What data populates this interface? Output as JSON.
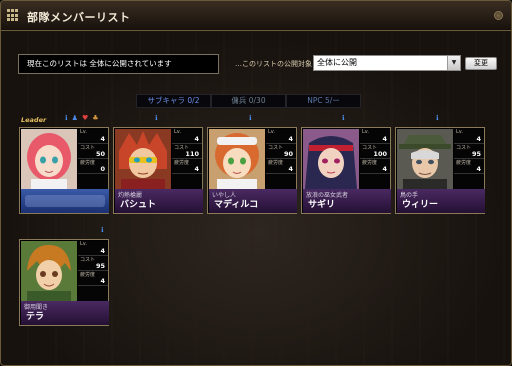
{
  "window": {
    "title": "部隊メンバーリスト"
  },
  "status": {
    "text": "現在このリストは 全体に公開されています"
  },
  "scope": {
    "label": "…このリストの公開対象",
    "selected": "全体に公開",
    "change_label": "変更"
  },
  "counts": {
    "sub": "サブキャラ 0/2",
    "merc": "傭兵 0/30",
    "npc": "NPC 5/ー"
  },
  "leader_label": "Leader",
  "stat_labels": {
    "lv": "Lv.",
    "cost": "コスト",
    "fatigue": "疲労度"
  },
  "members": [
    {
      "title": "",
      "name": "",
      "lv": "4",
      "cost": "50",
      "fatigue": "0",
      "hair": "#e85a6a",
      "bg": "#d9c6b8"
    },
    {
      "title": "灼熱槍麗",
      "name": "バシュト",
      "lv": "4",
      "cost": "110",
      "fatigue": "4",
      "hair": "#c8452a",
      "bg": "#8a3a22"
    },
    {
      "title": "いやし人",
      "name": "マディルコ",
      "lv": "4",
      "cost": "90",
      "fatigue": "4",
      "hair": "#d86a30",
      "bg": "#c8a070"
    },
    {
      "title": "放浪の巫女武者",
      "name": "サギリ",
      "lv": "4",
      "cost": "100",
      "fatigue": "4",
      "hair": "#2a2850",
      "bg": "#8a5a8a"
    },
    {
      "title": "鳥の手",
      "name": "ウィリー",
      "lv": "4",
      "cost": "95",
      "fatigue": "4",
      "hair": "#d8d8d8",
      "bg": "#5a5a52"
    },
    {
      "title": "御用聞き",
      "name": "テラ",
      "lv": "4",
      "cost": "95",
      "fatigue": "4",
      "hair": "#c87a22",
      "bg": "#5a7a3a"
    }
  ],
  "colors": {
    "accent": "#4a2a62",
    "leader_plate": "#2a4a98",
    "border": "#8a7a5a"
  }
}
